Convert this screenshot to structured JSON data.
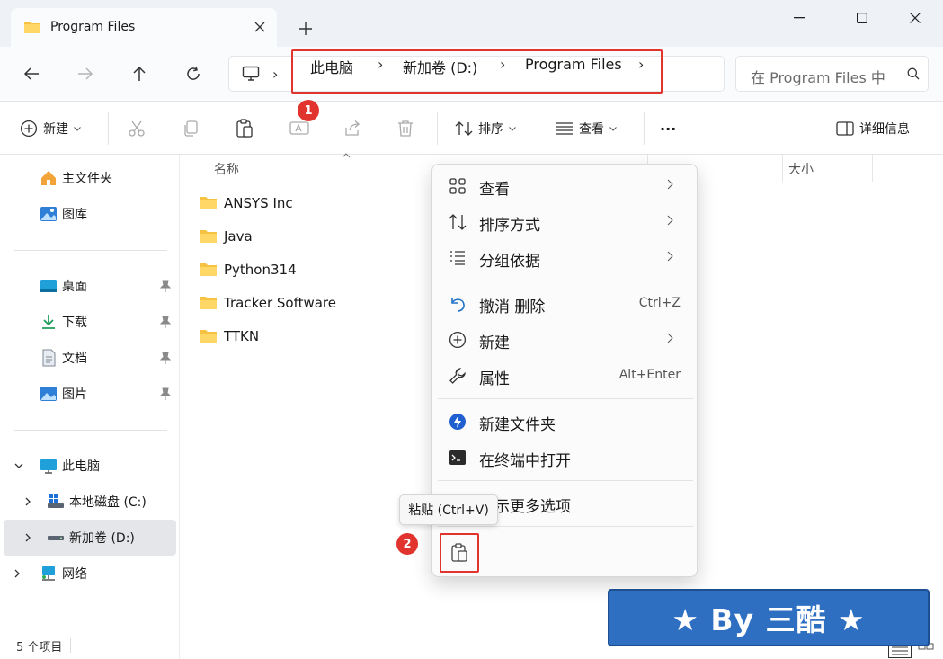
{
  "window": {
    "tab_title": "Program Files",
    "new_tab": "+"
  },
  "nav": {
    "breadcrumbs": [
      "此电脑",
      "新加卷 (D:)",
      "Program Files"
    ],
    "search_placeholder": "在 Program Files 中"
  },
  "toolbar": {
    "new_label": "新建",
    "sort_label": "排序",
    "view_label": "查看",
    "more_label": "···",
    "details_label": "详细信息",
    "badge1": "1"
  },
  "sidebar": {
    "home": "主文件夹",
    "gallery": "图库",
    "desktop": "桌面",
    "downloads": "下载",
    "documents": "文档",
    "pictures": "图片",
    "this_pc": "此电脑",
    "local_disk": "本地磁盘 (C:)",
    "new_volume": "新加卷 (D:)",
    "network": "网络"
  },
  "filelist": {
    "col_name": "名称",
    "col_size": "大小",
    "files": [
      "ANSYS Inc",
      "Java",
      "Python314",
      "Tracker Software",
      "TTKN"
    ]
  },
  "status": {
    "count": "5 个项目"
  },
  "context_menu": {
    "view": "查看",
    "sort_by": "排序方式",
    "group_by": "分组依据",
    "undo": "撤消 删除",
    "undo_shortcut": "Ctrl+Z",
    "new": "新建",
    "properties": "属性",
    "properties_shortcut": "Alt+Enter",
    "new_folder": "新建文件夹",
    "open_terminal": "在终端中打开",
    "more_options": "显示更多选项"
  },
  "tooltip": {
    "paste": "粘贴 (Ctrl+V)",
    "badge2": "2"
  },
  "banner": {
    "text": "★ By 三酷 ★"
  },
  "colors": {
    "accent_red": "#e2342f",
    "banner_blue": "#2e6fc2",
    "folder_yellow": "#f5c242"
  }
}
